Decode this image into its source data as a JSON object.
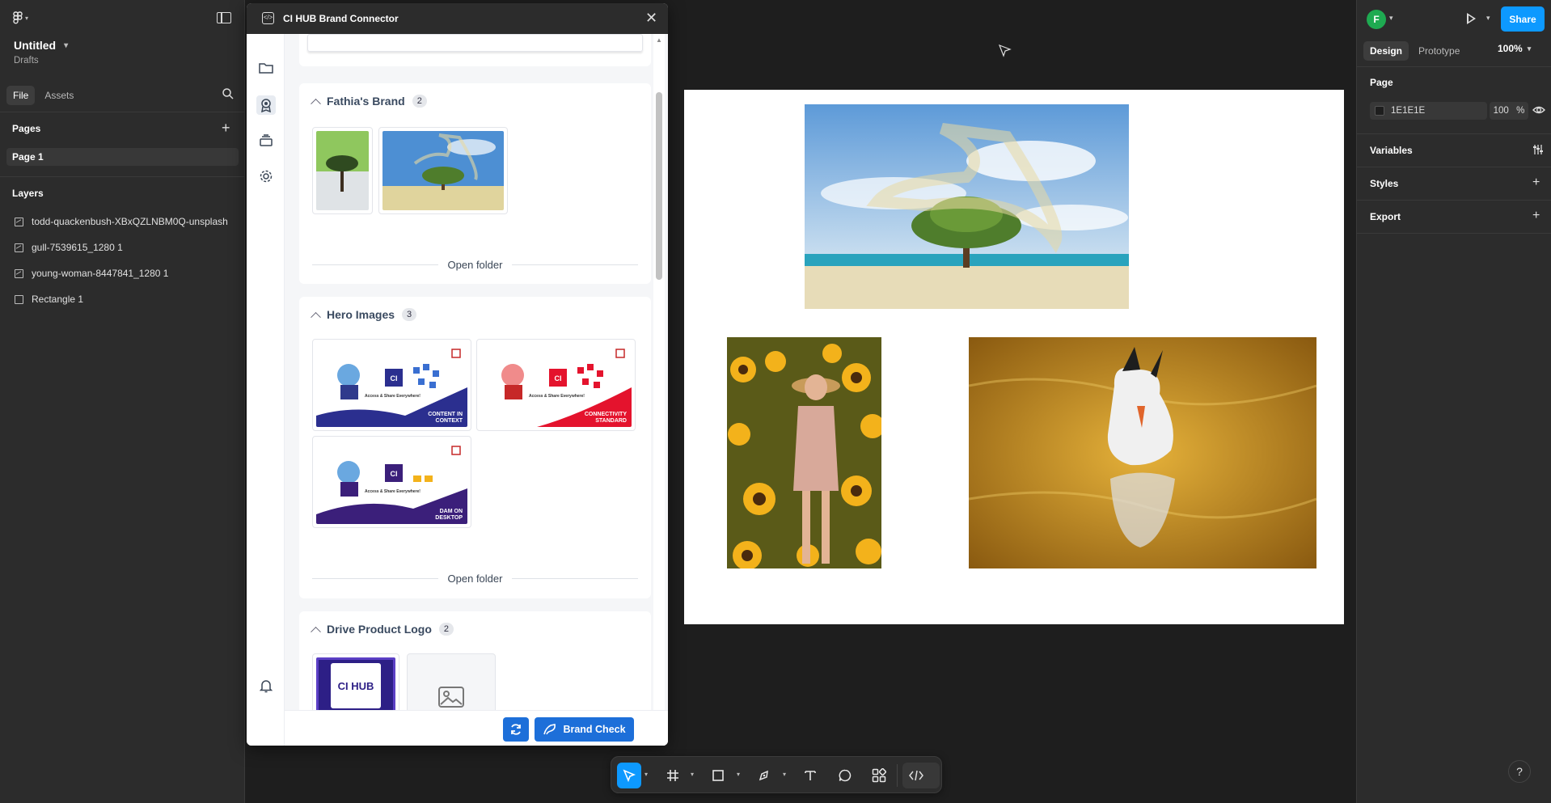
{
  "left_sidebar": {
    "file_title": "Untitled",
    "file_location": "Drafts",
    "tabs": [
      {
        "label": "File",
        "active": true
      },
      {
        "label": "Assets",
        "active": false
      }
    ],
    "pages_title": "Pages",
    "pages": [
      {
        "label": "Page 1",
        "selected": true
      }
    ],
    "layers_title": "Layers",
    "layers": [
      {
        "label": "todd-quackenbush-XBxQZLNBM0Q-unsplash",
        "icon": "image-icon"
      },
      {
        "label": "gull-7539615_1280 1",
        "icon": "image-icon"
      },
      {
        "label": "young-woman-8447841_1280 1",
        "icon": "image-icon"
      },
      {
        "label": "Rectangle 1",
        "icon": "rectangle-icon"
      }
    ]
  },
  "plugin": {
    "title": "CI HUB Brand Connector",
    "sections": [
      {
        "title": "Fathia's Brand",
        "count": "2",
        "open_label": "Open folder"
      },
      {
        "title": "Hero Images",
        "count": "3",
        "open_label": "Open folder",
        "thumbs": [
          {
            "caption": "CONTENT IN CONTEXT",
            "sub": "Access & Share Everywhere!",
            "accent": "#2b2f8f"
          },
          {
            "caption": "CONNECTIVITY STANDARD",
            "sub": "Access & Share Everywhere!",
            "accent": "#e4132d"
          },
          {
            "caption": "DAM ON DESKTOP",
            "sub": "Access & Share Everywhere!",
            "accent": "#3b1f7a"
          }
        ]
      },
      {
        "title": "Drive Product Logo",
        "count": "2",
        "logo_text": "CI HUB"
      }
    ],
    "refresh_icon": "refresh-icon",
    "brand_check_label": "Brand Check",
    "accent": "#1d6fd9"
  },
  "right_panel": {
    "avatar_initial": "F",
    "share_label": "Share",
    "tabs": [
      {
        "label": "Design",
        "active": true
      },
      {
        "label": "Prototype",
        "active": false
      }
    ],
    "zoom": "100%",
    "page_section": "Page",
    "page_color": "1E1E1E",
    "page_opacity": "100",
    "percent": "%",
    "variables_label": "Variables",
    "styles_label": "Styles",
    "export_label": "Export",
    "share_color": "#0d99ff"
  },
  "toolbar": {
    "tools": [
      "move-tool",
      "frame-tool",
      "rectangle-tool",
      "pen-tool",
      "text-tool",
      "comment-tool",
      "actions-tool",
      "dev-mode-toggle"
    ]
  },
  "help_label": "?"
}
